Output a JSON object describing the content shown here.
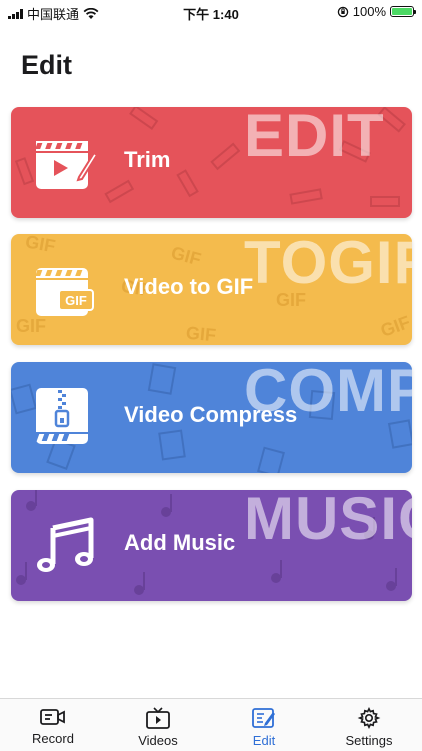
{
  "status_bar": {
    "carrier": "中国联通",
    "time": "下午 1:40",
    "battery": "100%"
  },
  "page": {
    "title": "Edit"
  },
  "cards": [
    {
      "label": "Trim",
      "bg_word": "EDIT",
      "color": "#e5535a",
      "icon": "video-edit-icon"
    },
    {
      "label": "Video to GIF",
      "bg_word": "TOGIF",
      "color": "#f4bb4d",
      "icon": "gif-icon"
    },
    {
      "label": "Video Compress",
      "bg_word": "COMPRESS",
      "color": "#4f84d9",
      "icon": "compress-zip-icon"
    },
    {
      "label": "Add Music",
      "bg_word": "MUSIC",
      "color": "#7a4fb1",
      "icon": "music-note-icon"
    }
  ],
  "tabs": [
    {
      "label": "Record",
      "icon": "camera-icon",
      "active": false
    },
    {
      "label": "Videos",
      "icon": "tv-play-icon",
      "active": false
    },
    {
      "label": "Edit",
      "icon": "edit-document-icon",
      "active": true
    },
    {
      "label": "Settings",
      "icon": "gear-icon",
      "active": false
    }
  ],
  "colors": {
    "accent": "#2f6fd6",
    "text": "#1c1c1e"
  }
}
